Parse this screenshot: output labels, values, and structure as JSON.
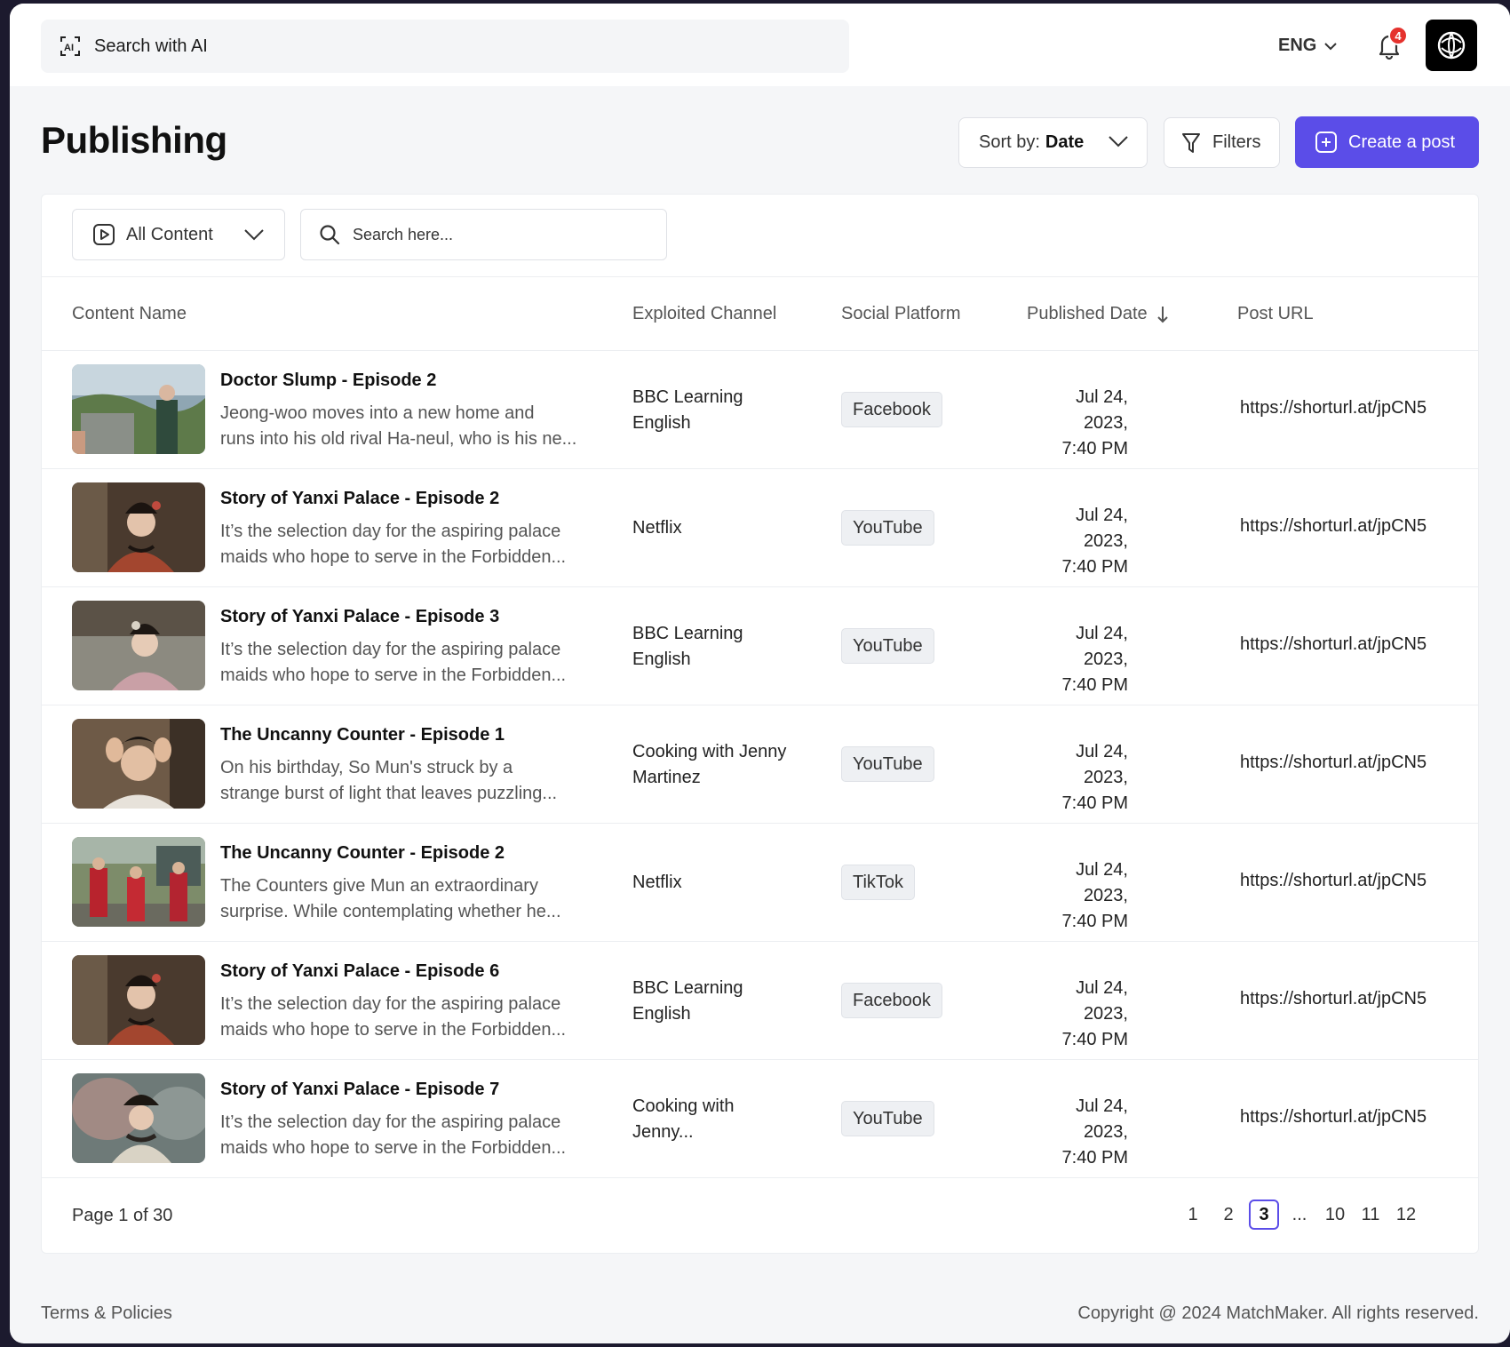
{
  "topbar": {
    "ai_search_label": "Search with AI",
    "language": "ENG",
    "notification_count": "4"
  },
  "header": {
    "title": "Publishing",
    "sort_prefix": "Sort by:",
    "sort_value": "Date",
    "filters_label": "Filters",
    "create_label": "Create a post"
  },
  "toolbar": {
    "content_filter": "All Content",
    "search_placeholder": "Search here..."
  },
  "table": {
    "columns": [
      "Content Name",
      "Exploited Channel",
      "Social Platform",
      "Published Date",
      "Post URL"
    ],
    "rows": [
      {
        "title": "Doctor Slump - Episode 2",
        "desc1": "Jeong-woo moves into a new home and",
        "desc2": "runs into his old rival Ha-neul, who is his ne...",
        "channel1": "BBC Learning",
        "channel2": "English",
        "platform": "Facebook",
        "date1": "Jul 24, 2023,",
        "date2": "7:40 PM",
        "url": "https://shorturl.at/jpCN5"
      },
      {
        "title": "Story of Yanxi Palace - Episode 2",
        "desc1": "It’s the selection day for the aspiring palace",
        "desc2": "maids who hope to serve in the Forbidden...",
        "channel1": "Netflix",
        "channel2": "",
        "platform": "YouTube",
        "date1": "Jul 24, 2023,",
        "date2": "7:40 PM",
        "url": "https://shorturl.at/jpCN5"
      },
      {
        "title": "Story of Yanxi Palace - Episode 3",
        "desc1": "It’s the selection day for the aspiring palace",
        "desc2": "maids who hope to serve in the Forbidden...",
        "channel1": "BBC Learning",
        "channel2": "English",
        "platform": "YouTube",
        "date1": "Jul 24, 2023,",
        "date2": "7:40 PM",
        "url": "https://shorturl.at/jpCN5"
      },
      {
        "title": "The Uncanny Counter - Episode 1",
        "desc1": "On his birthday, So Mun's struck by a",
        "desc2": "strange burst of light that leaves puzzling...",
        "channel1": "Cooking with Jenny",
        "channel2": "Martinez",
        "platform": "YouTube",
        "date1": "Jul 24, 2023,",
        "date2": "7:40 PM",
        "url": "https://shorturl.at/jpCN5"
      },
      {
        "title": "The Uncanny Counter - Episode 2",
        "desc1": "The Counters give Mun an extraordinary",
        "desc2": "surprise. While contemplating whether he...",
        "channel1": "Netflix",
        "channel2": "",
        "platform": "TikTok",
        "date1": "Jul 24, 2023,",
        "date2": "7:40 PM",
        "url": "https://shorturl.at/jpCN5"
      },
      {
        "title": "Story of Yanxi Palace - Episode 6",
        "desc1": "It’s the selection day for the aspiring palace",
        "desc2": "maids who hope to serve in the Forbidden...",
        "channel1": "BBC Learning",
        "channel2": "English",
        "platform": "Facebook",
        "date1": "Jul 24, 2023,",
        "date2": "7:40 PM",
        "url": "https://shorturl.at/jpCN5"
      },
      {
        "title": "Story of Yanxi Palace - Episode 7",
        "desc1": "It’s the selection day for the aspiring palace",
        "desc2": "maids who hope to serve in the Forbidden...",
        "channel1": "Cooking with",
        "channel2": "Jenny...",
        "platform": "YouTube",
        "date1": "Jul 24, 2023,",
        "date2": "7:40 PM",
        "url": "https://shorturl.at/jpCN5"
      }
    ]
  },
  "pagination": {
    "label": "Page 1 of 30",
    "pages": [
      "1",
      "2",
      "3",
      "...",
      "10",
      "11",
      "12"
    ],
    "active": "3"
  },
  "footer": {
    "left": "Terms & Policies",
    "right": "Copyright @ 2024 MatchMaker. All rights reserved."
  },
  "colors": {
    "accent": "#5b4de8",
    "badge": "#e5322d"
  },
  "icons": [
    "ai-search-icon",
    "chevron-down-icon",
    "bell-icon",
    "logo-icon",
    "funnel-icon",
    "plus-square-icon",
    "play-square-icon",
    "search-icon",
    "arrow-down-icon"
  ]
}
